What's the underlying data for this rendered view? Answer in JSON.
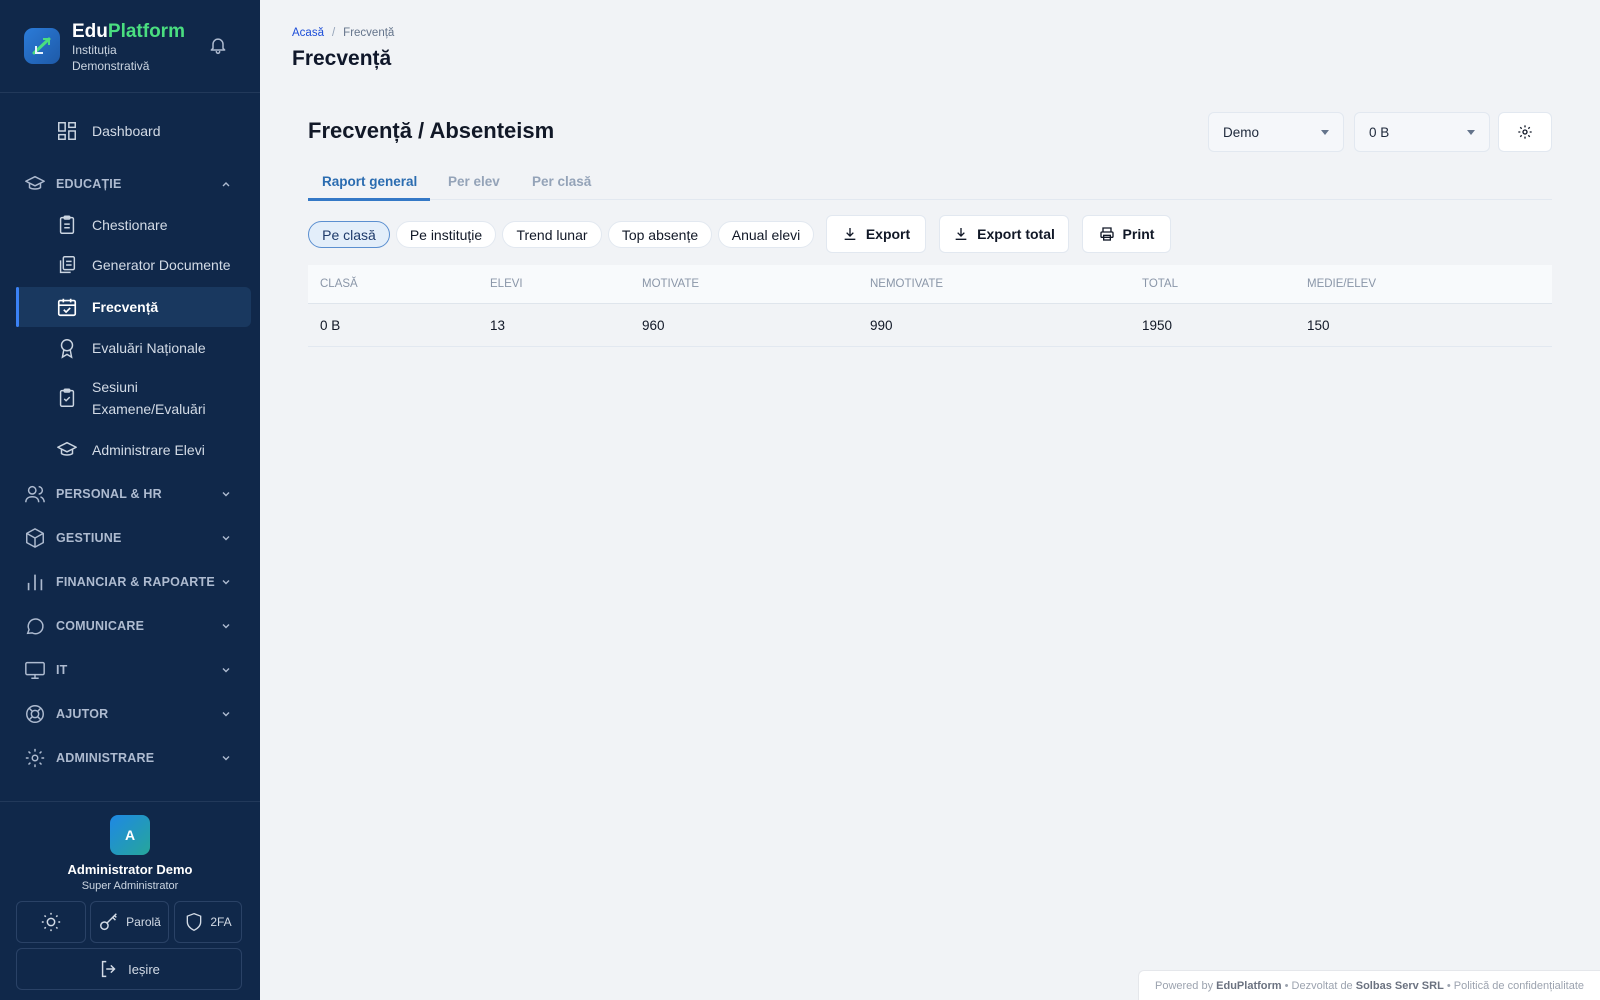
{
  "brand": {
    "name_main": "Edu",
    "name_accent": "Platform",
    "subtitle": "Instituția Demonstrativă"
  },
  "sidebar": {
    "dashboard": "Dashboard",
    "education_section": "EDUCAȚIE",
    "education_items": [
      {
        "label": "Chestionare",
        "icon": "clipboard-icon"
      },
      {
        "label": "Generator Documente",
        "icon": "documents-icon"
      },
      {
        "label": "Frecvență",
        "icon": "calendar-check-icon"
      },
      {
        "label": "Evaluări Naționale",
        "icon": "award-icon"
      },
      {
        "label": "Sesiuni Examene/Evaluări",
        "icon": "clipboard-check-icon"
      },
      {
        "label": "Administrare Elevi",
        "icon": "graduation-cap-icon"
      }
    ],
    "sections": [
      {
        "label": "PERSONAL & HR",
        "icon": "users-icon"
      },
      {
        "label": "GESTIUNE",
        "icon": "box-icon"
      },
      {
        "label": "FINANCIAR & RAPOARTE",
        "icon": "bar-chart-icon"
      },
      {
        "label": "COMUNICARE",
        "icon": "chat-icon"
      },
      {
        "label": "IT",
        "icon": "monitor-icon"
      },
      {
        "label": "AJUTOR",
        "icon": "lifebuoy-icon"
      },
      {
        "label": "ADMINISTRARE",
        "icon": "gear-icon"
      }
    ]
  },
  "user": {
    "avatar_letter": "A",
    "name": "Administrator Demo",
    "role": "Super Administrator",
    "password_label": "Parolă",
    "twofa_label": "2FA",
    "logout_label": "Ieșire"
  },
  "breadcrumb": {
    "home": "Acasă",
    "separator": "/",
    "current": "Frecvență"
  },
  "page_title": "Frecvență",
  "card": {
    "title": "Frecvență / Absenteism",
    "institution_select": "Demo",
    "class_select": "0 B"
  },
  "tabs": [
    "Raport general",
    "Per elev",
    "Per clasă"
  ],
  "filters": [
    "Pe clasă",
    "Pe instituție",
    "Trend lunar",
    "Top absențe",
    "Anual elevi"
  ],
  "actions": {
    "export": "Export",
    "export_total": "Export total",
    "print": "Print"
  },
  "table": {
    "headers": [
      "CLASĂ",
      "ELEVI",
      "MOTIVATE",
      "NEMOTIVATE",
      "TOTAL",
      "MEDIE/ELEV"
    ],
    "rows": [
      [
        "0 B",
        "13",
        "960",
        "990",
        "1950",
        "150"
      ]
    ]
  },
  "footer": {
    "powered_prefix": "Powered by",
    "powered_brand": "EduPlatform",
    "dev_prefix": "• Dezvoltat de",
    "dev_name": "Solbas Serv SRL",
    "privacy": "• Politică de confidențialitate"
  },
  "colors": {
    "sidebar_bg": "#10284a",
    "accent_blue": "#3478c6",
    "brand_green": "#4ade80"
  }
}
